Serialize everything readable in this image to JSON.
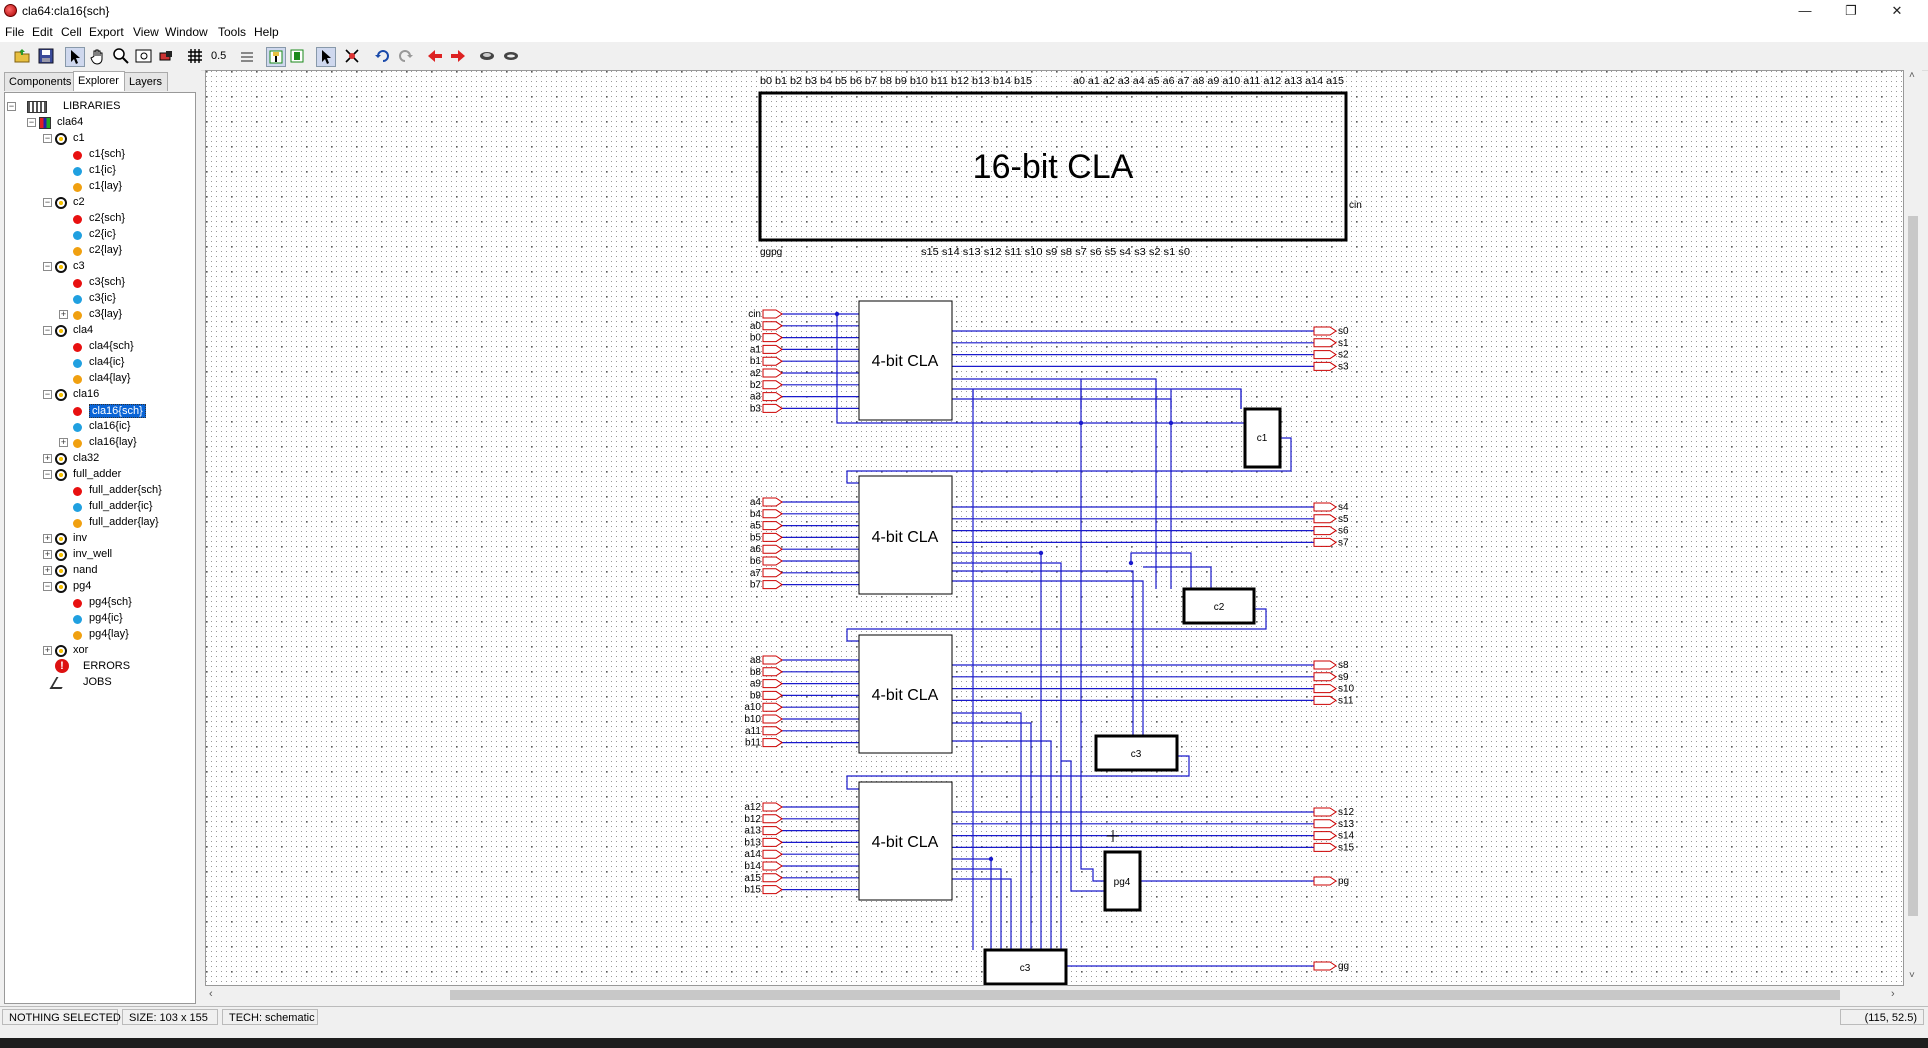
{
  "window": {
    "title": "cla64:cla16{sch}",
    "min": "—",
    "max": "❐",
    "close": "✕"
  },
  "menu": [
    "File",
    "Edit",
    "Cell",
    "Export",
    "View",
    "Window",
    "Tools",
    "Help"
  ],
  "toolbar": {
    "grid_value": "0.5"
  },
  "explorer": {
    "tabs": [
      "Components",
      "Explorer",
      "Layers"
    ],
    "active_tab": "Explorer",
    "tree": [
      {
        "label": "LIBRARIES",
        "level": 0,
        "type": "libraries",
        "exp": "-"
      },
      {
        "label": "cla64",
        "level": 1,
        "type": "library",
        "exp": "-"
      },
      {
        "label": "c1",
        "level": 2,
        "type": "cell",
        "exp": "-"
      },
      {
        "label": "c1{sch}",
        "level": 3,
        "type": "sch"
      },
      {
        "label": "c1{ic}",
        "level": 3,
        "type": "ic"
      },
      {
        "label": "c1{lay}",
        "level": 3,
        "type": "lay"
      },
      {
        "label": "c2",
        "level": 2,
        "type": "cell",
        "exp": "-"
      },
      {
        "label": "c2{sch}",
        "level": 3,
        "type": "sch"
      },
      {
        "label": "c2{ic}",
        "level": 3,
        "type": "ic"
      },
      {
        "label": "c2{lay}",
        "level": 3,
        "type": "lay"
      },
      {
        "label": "c3",
        "level": 2,
        "type": "cell",
        "exp": "-"
      },
      {
        "label": "c3{sch}",
        "level": 3,
        "type": "sch"
      },
      {
        "label": "c3{ic}",
        "level": 3,
        "type": "ic"
      },
      {
        "label": "c3{lay}",
        "level": 3,
        "type": "lay",
        "exp": "+"
      },
      {
        "label": "cla4",
        "level": 2,
        "type": "cell",
        "exp": "-"
      },
      {
        "label": "cla4{sch}",
        "level": 3,
        "type": "sch"
      },
      {
        "label": "cla4{ic}",
        "level": 3,
        "type": "ic"
      },
      {
        "label": "cla4{lay}",
        "level": 3,
        "type": "lay"
      },
      {
        "label": "cla16",
        "level": 2,
        "type": "cell",
        "exp": "-"
      },
      {
        "label": "cla16{sch}",
        "level": 3,
        "type": "sch",
        "selected": true
      },
      {
        "label": "cla16{ic}",
        "level": 3,
        "type": "ic"
      },
      {
        "label": "cla16{lay}",
        "level": 3,
        "type": "lay",
        "exp": "+"
      },
      {
        "label": "cla32",
        "level": 2,
        "type": "cell",
        "exp": "+"
      },
      {
        "label": "full_adder",
        "level": 2,
        "type": "cell",
        "exp": "-"
      },
      {
        "label": "full_adder{sch}",
        "level": 3,
        "type": "sch"
      },
      {
        "label": "full_adder{ic}",
        "level": 3,
        "type": "ic"
      },
      {
        "label": "full_adder{lay}",
        "level": 3,
        "type": "lay"
      },
      {
        "label": "inv",
        "level": 2,
        "type": "cell",
        "exp": "+"
      },
      {
        "label": "inv_well",
        "level": 2,
        "type": "cell",
        "exp": "+"
      },
      {
        "label": "nand",
        "level": 2,
        "type": "cell",
        "exp": "+"
      },
      {
        "label": "pg4",
        "level": 2,
        "type": "cell",
        "exp": "-"
      },
      {
        "label": "pg4{sch}",
        "level": 3,
        "type": "sch"
      },
      {
        "label": "pg4{ic}",
        "level": 3,
        "type": "ic"
      },
      {
        "label": "pg4{lay}",
        "level": 3,
        "type": "lay"
      },
      {
        "label": "xor",
        "level": 2,
        "type": "cell",
        "exp": "+"
      },
      {
        "label": "ERRORS",
        "level": 1,
        "type": "errors"
      },
      {
        "label": "JOBS",
        "level": 1,
        "type": "jobs"
      }
    ]
  },
  "schematic": {
    "top_block": {
      "label": "16-bit CLA",
      "top_pins": "b0 b1 b2 b3 b4 b5 b6 b7 b8 b9 b10 b11 b12 b13 b14 b15",
      "top_pins_a": "a0 a1 a2 a3 a4 a5 a6 a7 a8 a9 a10 a11 a12 a13 a14 a15",
      "bottom_left": "ggpg",
      "bottom_pins": "s15 s14 s13 s12 s11 s10 s9 s8 s7 s6 s5 s4 s3 s2 s1 s0",
      "right_pin": "cin"
    },
    "cla_label": "4-bit CLA",
    "groups": [
      {
        "inputs": [
          "cin",
          "a0",
          "b0",
          "a1",
          "b1",
          "a2",
          "b2",
          "a3",
          "b3"
        ],
        "outputs": [
          "s0",
          "s1",
          "s2",
          "s3"
        ]
      },
      {
        "inputs": [
          "a4",
          "b4",
          "a5",
          "b5",
          "a6",
          "b6",
          "a7",
          "b7"
        ],
        "outputs": [
          "s4",
          "s5",
          "s6",
          "s7"
        ]
      },
      {
        "inputs": [
          "a8",
          "b8",
          "a9",
          "b9",
          "a10",
          "b10",
          "a11",
          "b11"
        ],
        "outputs": [
          "s8",
          "s9",
          "s10",
          "s11"
        ]
      },
      {
        "inputs": [
          "a12",
          "b12",
          "a13",
          "b13",
          "a14",
          "b14",
          "a15",
          "b15"
        ],
        "outputs": [
          "s12",
          "s13",
          "s14",
          "s15"
        ]
      }
    ],
    "blocks": {
      "c1": "c1",
      "c2": "c2",
      "c3a": "c3",
      "pg4": "pg4",
      "c3b": "c3"
    },
    "out_pg": "pg",
    "out_gg": "gg",
    "colors": {
      "wire": "#1a1acc",
      "pin": "#cc0000",
      "block": "#000000",
      "grid": "#9a9a9a"
    }
  },
  "status": {
    "selection": "NOTHING SELECTED",
    "size": "SIZE: 103 x 155",
    "tech": "TECH: schematic",
    "coords": "(115, 52.5)"
  }
}
